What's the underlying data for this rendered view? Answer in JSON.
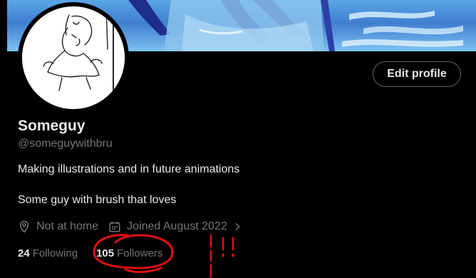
{
  "profile": {
    "display_name": "Someguy",
    "handle": "@someguywithbru",
    "bio_line1": "Making illustrations and in future animations",
    "bio_line2": "Some guy with brush that loves",
    "location": "Not at home",
    "joined": "Joined August 2022",
    "edit_label": "Edit profile"
  },
  "stats": {
    "following_count": "24",
    "following_label": "Following",
    "followers_count": "105",
    "followers_label": "Followers"
  },
  "annotation": {
    "text": "!!",
    "color": "#e01010"
  },
  "icons": {
    "location": "location-pin-icon",
    "calendar": "calendar-icon",
    "chevron": "chevron-right-icon"
  },
  "colors": {
    "background": "#000000",
    "primary_text": "#e7e9ea",
    "secondary_text": "#71767b",
    "button_border": "#536471",
    "annotation": "#e01010"
  }
}
